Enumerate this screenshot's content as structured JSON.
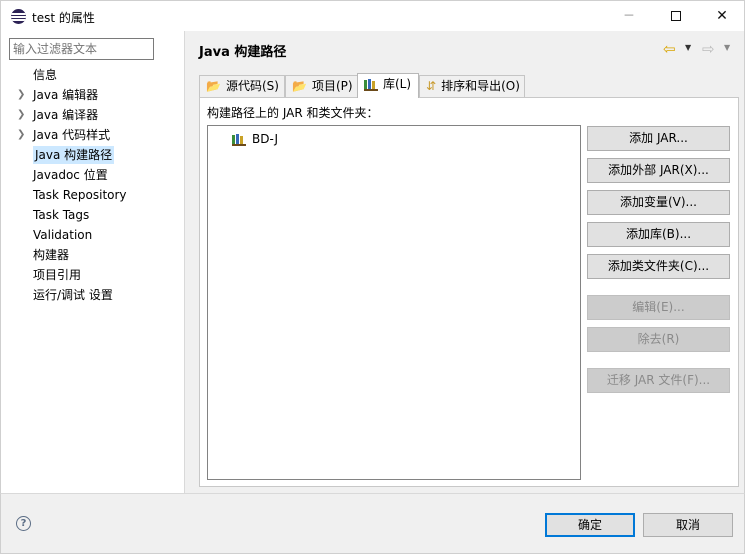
{
  "window": {
    "title": "test 的属性",
    "minimize": "─",
    "close": "✕"
  },
  "left": {
    "filter_placeholder": "输入过滤器文本",
    "items": [
      {
        "label": "信息",
        "expandable": false
      },
      {
        "label": "Java 编辑器",
        "expandable": true
      },
      {
        "label": "Java 编译器",
        "expandable": true
      },
      {
        "label": "Java 代码样式",
        "expandable": true
      },
      {
        "label": "Java 构建路径",
        "expandable": false,
        "selected": true
      },
      {
        "label": "Javadoc 位置",
        "expandable": false
      },
      {
        "label": "Task Repository",
        "expandable": false
      },
      {
        "label": "Task Tags",
        "expandable": false
      },
      {
        "label": "Validation",
        "expandable": false
      },
      {
        "label": "构建器",
        "expandable": false
      },
      {
        "label": "项目引用",
        "expandable": false
      },
      {
        "label": "运行/调试 设置",
        "expandable": false
      }
    ]
  },
  "right": {
    "title": "Java 构建路径",
    "tabs": [
      {
        "label": "源代码(S)",
        "icon": "source-folder-icon"
      },
      {
        "label": "项目(P)",
        "icon": "project-folder-icon"
      },
      {
        "label": "库(L)",
        "icon": "library-icon",
        "active": true
      },
      {
        "label": "排序和导出(O)",
        "icon": "order-export-icon"
      }
    ],
    "list_label": "构建路径上的 JAR 和类文件夹：",
    "list_items": [
      "BD-J"
    ],
    "buttons": {
      "add_jar": "添加 JAR...",
      "add_external_jar": "添加外部 JAR(X)...",
      "add_variable": "添加变量(V)...",
      "add_library": "添加库(B)...",
      "add_class_folder": "添加类文件夹(C)...",
      "edit": "编辑(E)...",
      "remove": "除去(R)",
      "migrate_jar": "迁移 JAR 文件(F)..."
    }
  },
  "bottom": {
    "help": "?",
    "ok": "确定",
    "cancel": "取消"
  },
  "colors": {
    "selection": "#cce8ff",
    "default_button_border": "#0078d7",
    "panel_bg": "#f0f0f0"
  }
}
